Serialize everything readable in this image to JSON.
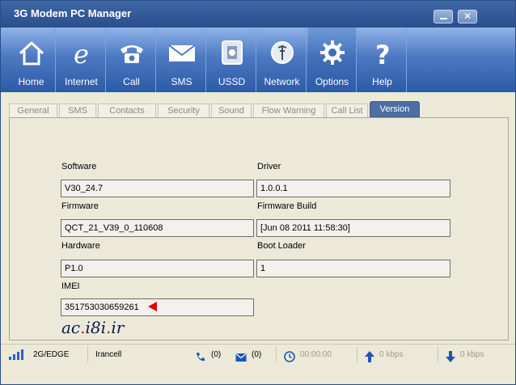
{
  "window": {
    "title": "3G Modem PC Manager"
  },
  "toolbar": {
    "items": [
      {
        "label": "Home",
        "icon": "home-icon"
      },
      {
        "label": "Internet",
        "icon": "internet-icon"
      },
      {
        "label": "Call",
        "icon": "phone-icon"
      },
      {
        "label": "SMS",
        "icon": "envelope-icon"
      },
      {
        "label": "USSD",
        "icon": "ussd-icon"
      },
      {
        "label": "Network",
        "icon": "network-icon"
      },
      {
        "label": "Options",
        "icon": "gear-icon"
      },
      {
        "label": "Help",
        "icon": "help-icon"
      }
    ],
    "active": "Options"
  },
  "tabs": {
    "items": [
      "General",
      "SMS",
      "Contacts",
      "Security",
      "Sound",
      "Flow Warning",
      "Call List",
      "Version"
    ],
    "active": "Version"
  },
  "version": {
    "software_label": "Software",
    "software_value": "V30_24.7",
    "driver_label": "Driver",
    "driver_value": "1.0.0.1",
    "firmware_label": "Firmware",
    "firmware_value": "QCT_21_V39_0_110608",
    "firmware_build_label": "Firmware Build",
    "firmware_build_value": "[Jun 08 2011 11:58:30]",
    "hardware_label": "Hardware",
    "hardware_value": "P1.0",
    "boot_loader_label": "Boot Loader",
    "boot_loader_value": "1",
    "imei_label": "IMEI",
    "imei_value": "351753030659261"
  },
  "watermark": {
    "part1": "ac",
    "dot1": ".",
    "part2": "i8i",
    "dot2": ".",
    "part3": "ir"
  },
  "status": {
    "network_type": "2G/EDGE",
    "operator": "Irancell",
    "calls": "(0)",
    "sms": "(0)",
    "duration": "00:00:00",
    "upload": "0 kbps",
    "download": "0 kbps"
  },
  "colors": {
    "accent": "#2c5aa6",
    "arrow": "#e00000"
  }
}
